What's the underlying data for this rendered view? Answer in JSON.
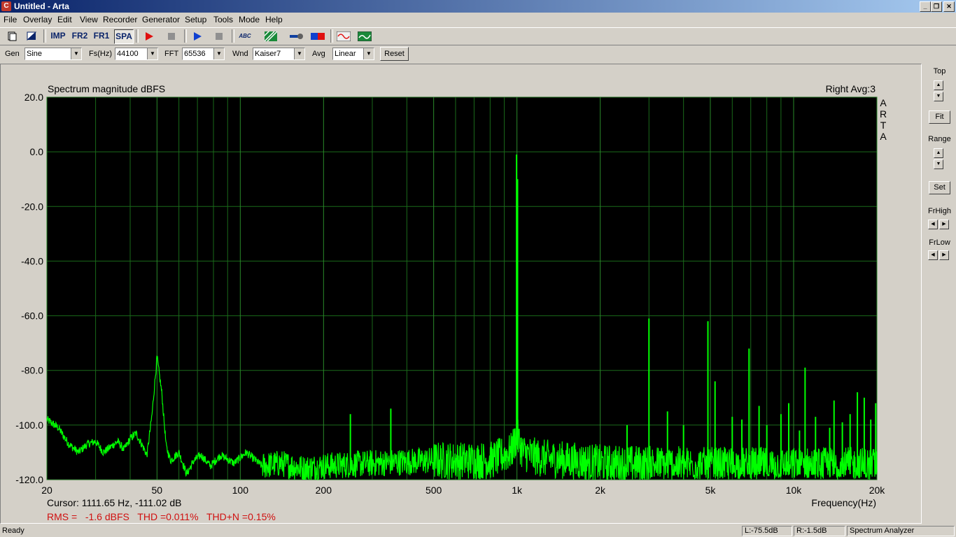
{
  "window": {
    "title": "Untitled - Arta",
    "app_icon_letter": "C"
  },
  "menu": [
    "File",
    "Overlay",
    "Edit",
    "View",
    "Recorder",
    "Generator",
    "Setup",
    "Tools",
    "Mode",
    "Help"
  ],
  "toolbar": {
    "imp": "IMP",
    "fr2": "FR2",
    "fr1": "FR1",
    "spa": "SPA",
    "abc": "ABC"
  },
  "controls": {
    "gen_label": "Gen",
    "gen_value": "Sine",
    "fs_label": "Fs(Hz)",
    "fs_value": "44100",
    "fft_label": "FFT",
    "fft_value": "65536",
    "wnd_label": "Wnd",
    "wnd_value": "Kaiser7",
    "avg_label": "Avg",
    "avg_value": "Linear",
    "reset_label": "Reset"
  },
  "plot": {
    "title": "Spectrum magnitude dBFS",
    "channel_info": "Right  Avg:3",
    "watermark": [
      "A",
      "R",
      "T",
      "A"
    ],
    "xlabel": "Frequency(Hz)",
    "cursor": "Cursor: 1111.65 Hz, -111.02 dB",
    "measurements": "RMS =   -1.6 dBFS   THD =0.011%   THD+N =0.15%"
  },
  "right_panel": {
    "top_label": "Top",
    "fit_label": "Fit",
    "range_label": "Range",
    "set_label": "Set",
    "frhigh_label": "FrHigh",
    "frlow_label": "FrLow"
  },
  "status": {
    "ready": "Ready",
    "left_level": "L:-75.5dB",
    "right_level": "R:-1.5dB",
    "mode": "Spectrum Analyzer"
  },
  "colors": {
    "trace": "#00ff00",
    "grid": "#1a6a1a",
    "plot_bg": "#000000",
    "measure_text": "#d01010"
  },
  "chart_data": {
    "type": "line",
    "title": "Spectrum magnitude dBFS",
    "xlabel": "Frequency(Hz)",
    "ylabel": "",
    "x_scale": "log",
    "xlim": [
      20,
      20000
    ],
    "ylim": [
      -120,
      20
    ],
    "grid": true,
    "x_tick_labels": [
      "20",
      "50",
      "100",
      "200",
      "500",
      "1k",
      "2k",
      "5k",
      "10k",
      "20k"
    ],
    "x_ticks": [
      20,
      50,
      100,
      200,
      500,
      1000,
      2000,
      5000,
      10000,
      20000
    ],
    "y_ticks": [
      20,
      0,
      -20,
      -40,
      -60,
      -80,
      -100,
      -120
    ],
    "y_tick_labels": [
      "20.0",
      "0.0",
      "-20.0",
      "-40.0",
      "-60.0",
      "-80.0",
      "-100.0",
      "-120.0"
    ],
    "series": [
      {
        "name": "",
        "baseline": [
          [
            20,
            -98
          ],
          [
            22,
            -101
          ],
          [
            24,
            -107
          ],
          [
            26,
            -110
          ],
          [
            28,
            -107
          ],
          [
            30,
            -106
          ],
          [
            32,
            -110
          ],
          [
            34,
            -108
          ],
          [
            36,
            -106
          ],
          [
            38,
            -109
          ],
          [
            40,
            -105
          ],
          [
            42,
            -103
          ],
          [
            44,
            -107
          ],
          [
            46,
            -111
          ],
          [
            48,
            -96
          ],
          [
            50,
            -75
          ],
          [
            52,
            -88
          ],
          [
            54,
            -108
          ],
          [
            56,
            -113
          ],
          [
            60,
            -110
          ],
          [
            64,
            -118
          ],
          [
            68,
            -113
          ],
          [
            72,
            -111
          ],
          [
            78,
            -115
          ],
          [
            85,
            -111
          ],
          [
            95,
            -114
          ],
          [
            105,
            -110
          ],
          [
            120,
            -115
          ],
          [
            140,
            -114
          ],
          [
            170,
            -116
          ],
          [
            200,
            -115
          ],
          [
            300,
            -114
          ],
          [
            500,
            -113
          ],
          [
            800,
            -113
          ],
          [
            950,
            -110
          ],
          [
            1000,
            -104
          ],
          [
            1050,
            -110
          ],
          [
            1200,
            -112
          ],
          [
            2000,
            -114
          ],
          [
            5000,
            -115
          ],
          [
            10000,
            -115
          ],
          [
            20000,
            -115
          ]
        ],
        "peaks": [
          [
            250,
            -96
          ],
          [
            350,
            -94
          ],
          [
            997,
            -1
          ],
          [
            1005,
            -10
          ],
          [
            2500,
            -100
          ],
          [
            3000,
            -61
          ],
          [
            3500,
            -95
          ],
          [
            4000,
            -100
          ],
          [
            4900,
            -62
          ],
          [
            5200,
            -84
          ],
          [
            6000,
            -97
          ],
          [
            6500,
            -98
          ],
          [
            6900,
            -72
          ],
          [
            7500,
            -93
          ],
          [
            8000,
            -100
          ],
          [
            9000,
            -96
          ],
          [
            9600,
            -92
          ],
          [
            10500,
            -102
          ],
          [
            11000,
            -79
          ],
          [
            12000,
            -97
          ],
          [
            13500,
            -101
          ],
          [
            14000,
            -91
          ],
          [
            15000,
            -99
          ],
          [
            16000,
            -96
          ],
          [
            17000,
            -88
          ],
          [
            18000,
            -90
          ],
          [
            19000,
            -98
          ],
          [
            19800,
            -92
          ]
        ]
      }
    ]
  }
}
